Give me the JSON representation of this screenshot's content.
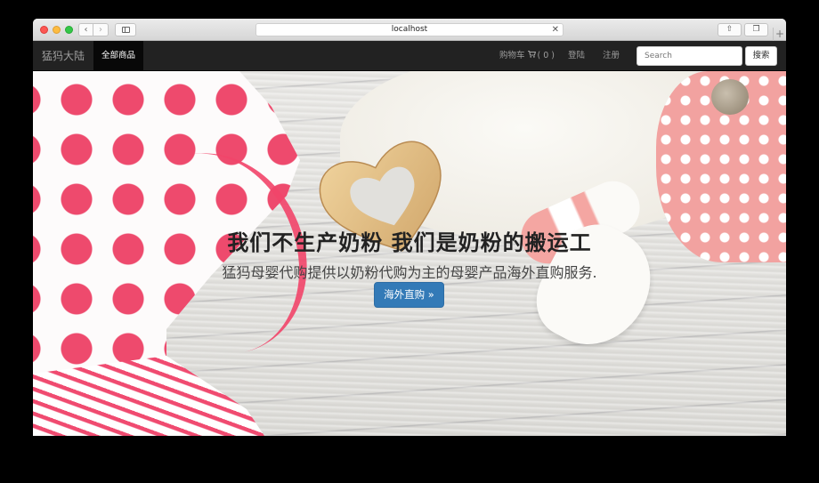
{
  "browser": {
    "url": "localhost",
    "nav_back": "‹",
    "nav_forward": "›",
    "clear": "✕",
    "share_glyph": "⇧",
    "tabs_glyph": "❐",
    "new_tab": "+"
  },
  "navbar": {
    "brand": "猛犸大陆",
    "active_item": "全部商品",
    "cart_label": "购物车",
    "cart_count": "( 0 )",
    "login": "登陆",
    "register": "注册",
    "search_placeholder": "Search",
    "search_button": "搜索"
  },
  "hero": {
    "title": "我们不生产奶粉 我们是奶粉的搬运工",
    "subtitle": "猛犸母婴代购提供以奶粉代购为主的母婴产品海外直购服务.",
    "cta": "海外直购 »"
  },
  "colors": {
    "primary": "#337ab7",
    "navbar_bg": "#222222",
    "polka_pink": "#ee4a6d"
  },
  "icons": [
    "back-arrow-icon",
    "forward-arrow-icon",
    "sidebar-icon",
    "clear-icon",
    "share-icon",
    "tabs-icon",
    "shopping-cart-icon"
  ]
}
